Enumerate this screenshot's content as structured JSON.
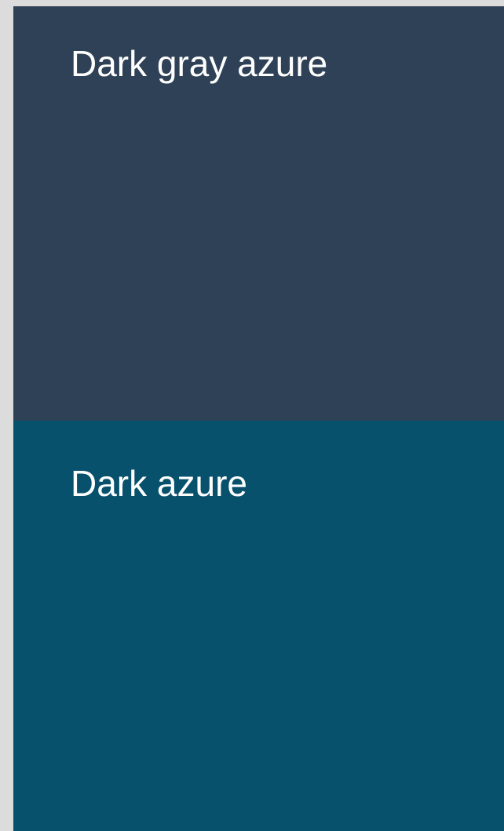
{
  "swatches": [
    {
      "label": "Dark gray azure",
      "color": "#2e4156"
    },
    {
      "label": "Dark azure",
      "color": "#08516c"
    }
  ],
  "colors": {
    "page_background": "#dcdcdc",
    "label_text": "#ffffff"
  }
}
